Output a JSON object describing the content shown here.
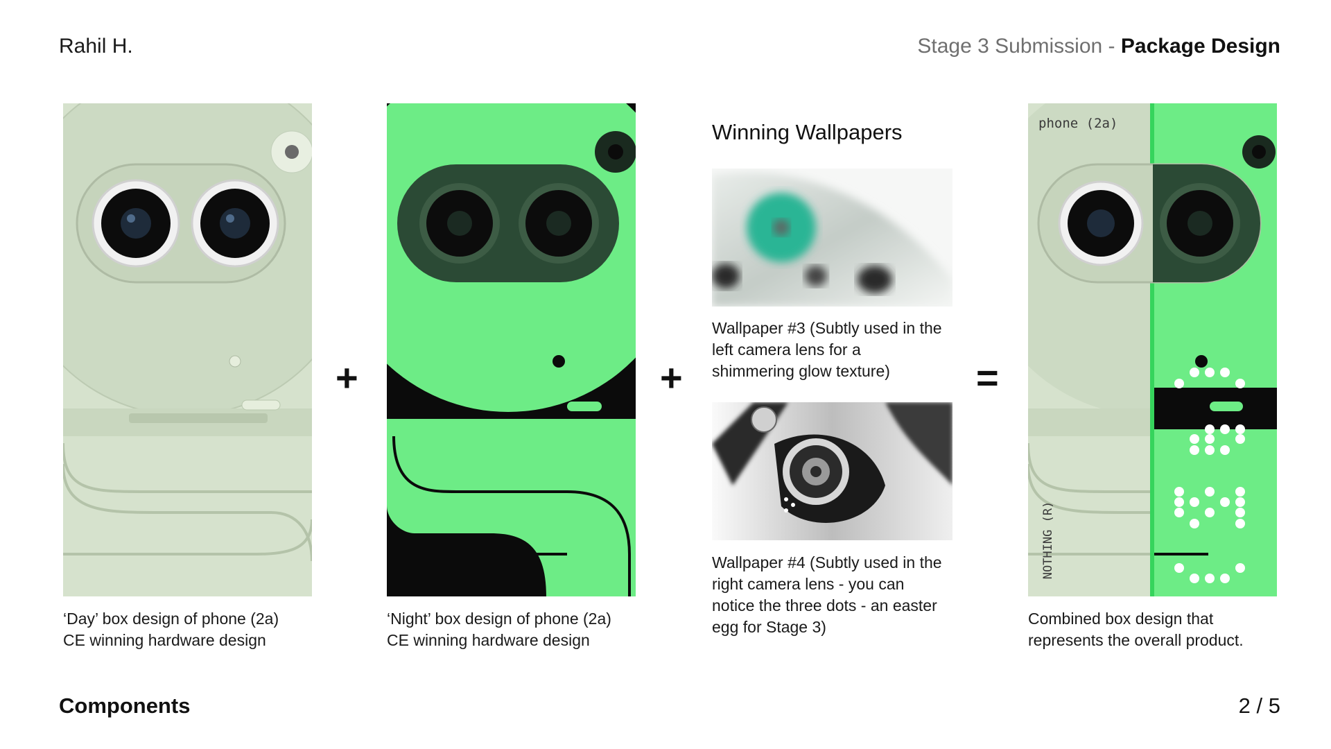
{
  "header": {
    "author": "Rahil H.",
    "stage_prefix": "Stage 3 Submission - ",
    "stage_bold": "Package Design"
  },
  "footer": {
    "section_label": "Components",
    "page_indicator": "2 / 5"
  },
  "operators": {
    "plus": "+",
    "equals": "="
  },
  "day_box": {
    "caption_line1": "‘Day’ box design of phone (2a)",
    "caption_line2": "CE winning hardware design"
  },
  "night_box": {
    "caption_line1": "‘Night’ box design of phone (2a)",
    "caption_line2": "CE winning hardware design"
  },
  "wallpapers": {
    "title": "Winning Wallpapers",
    "wp3_caption": [
      "Wallpaper #3 (Subtly used in the",
      "left camera lens for a",
      "shimmering glow texture)"
    ],
    "wp4_caption": [
      "Wallpaper #4 (Subtly used in the",
      "right camera lens - you can",
      "notice the three dots - an easter",
      "egg for Stage 3)"
    ]
  },
  "combined_box": {
    "phone_label": "phone (2a)",
    "brand_label": "NOTHING (R)",
    "caption_line1": "Combined box design that",
    "caption_line2": "represents the overall product."
  },
  "colors": {
    "neon_green": "#6DEC86",
    "sage": "#D6E2CD",
    "black": "#0b0b0b"
  }
}
